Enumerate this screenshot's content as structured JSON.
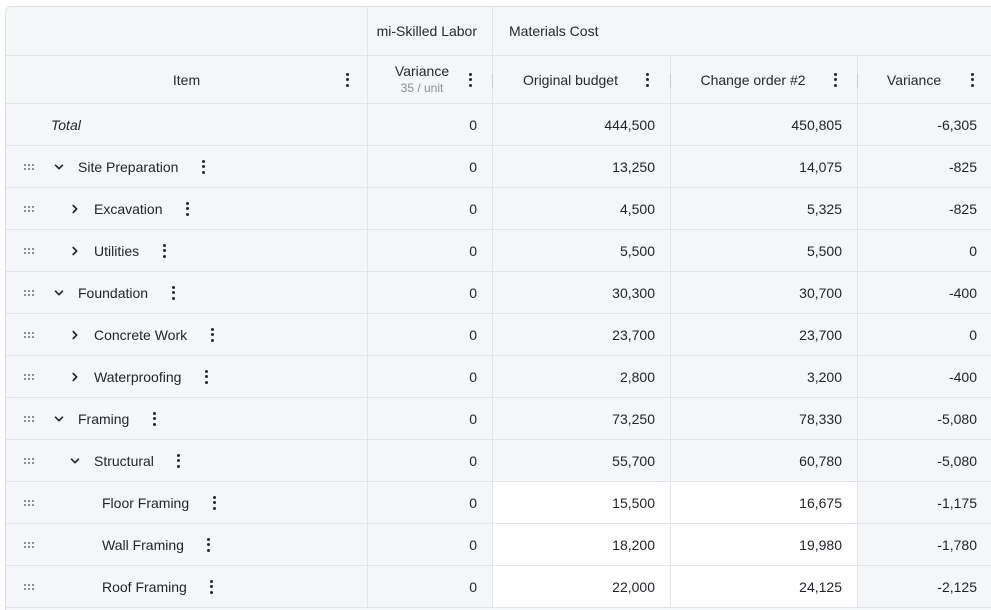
{
  "groups": {
    "semi_skilled": "mi-Skilled Labor",
    "materials": "Materials Cost"
  },
  "headers": {
    "item": "Item",
    "variance_labor": "Variance",
    "variance_labor_sub": "35 / unit",
    "original_budget": "Original budget",
    "change_order": "Change order #2",
    "variance": "Variance"
  },
  "total": {
    "label": "Total",
    "labor_variance": "0",
    "original_budget": "444,500",
    "change_order": "450,805",
    "variance": "-6,305"
  },
  "rows": [
    {
      "label": "Site Preparation",
      "expander": "chevron-down",
      "labor_variance": "0",
      "original_budget": "13,250",
      "change_order": "14,075",
      "variance": "-825"
    },
    {
      "label": "Excavation",
      "expander": "chevron-right",
      "labor_variance": "0",
      "original_budget": "4,500",
      "change_order": "5,325",
      "variance": "-825"
    },
    {
      "label": "Utilities",
      "expander": "chevron-right",
      "labor_variance": "0",
      "original_budget": "5,500",
      "change_order": "5,500",
      "variance": "0"
    },
    {
      "label": "Foundation",
      "expander": "chevron-down",
      "labor_variance": "0",
      "original_budget": "30,300",
      "change_order": "30,700",
      "variance": "-400"
    },
    {
      "label": "Concrete Work",
      "expander": "chevron-right",
      "labor_variance": "0",
      "original_budget": "23,700",
      "change_order": "23,700",
      "variance": "0"
    },
    {
      "label": "Waterproofing",
      "expander": "chevron-right",
      "labor_variance": "0",
      "original_budget": "2,800",
      "change_order": "3,200",
      "variance": "-400"
    },
    {
      "label": "Framing",
      "expander": "chevron-down",
      "labor_variance": "0",
      "original_budget": "73,250",
      "change_order": "78,330",
      "variance": "-5,080"
    },
    {
      "label": "Structural",
      "expander": "chevron-down",
      "labor_variance": "0",
      "original_budget": "55,700",
      "change_order": "60,780",
      "variance": "-5,080"
    },
    {
      "label": "Floor Framing",
      "expander": "none",
      "labor_variance": "0",
      "original_budget": "15,500",
      "change_order": "16,675",
      "variance": "-1,175"
    },
    {
      "label": "Wall Framing",
      "expander": "none",
      "labor_variance": "0",
      "original_budget": "18,200",
      "change_order": "19,980",
      "variance": "-1,780"
    },
    {
      "label": "Roof Framing",
      "expander": "none",
      "labor_variance": "0",
      "original_budget": "22,000",
      "change_order": "24,125",
      "variance": "-2,125"
    }
  ],
  "colors": {
    "header_bg": "#f3f7f8",
    "row_bg": "#f4f6f9",
    "editable_bg": "#ffffff",
    "border": "#e1e4e8"
  }
}
